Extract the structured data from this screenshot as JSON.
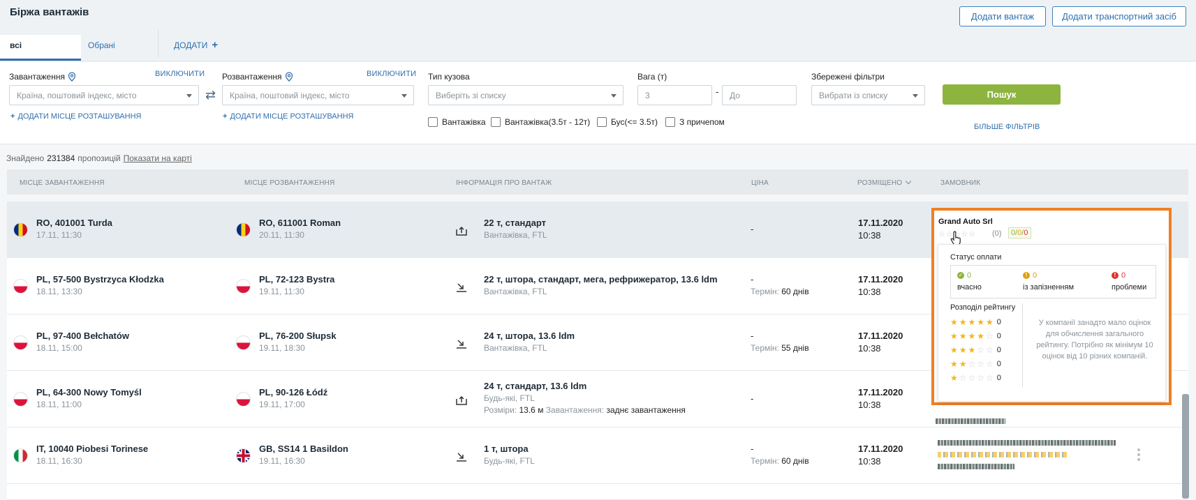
{
  "header": {
    "title": "Біржа вантажів",
    "add_cargo": "Додати вантаж",
    "add_vehicle": "Додати транспортний засіб"
  },
  "tabs": {
    "all": "всі",
    "favorites": "Обрані",
    "add": "ДОДАТИ"
  },
  "filters": {
    "loading_label": "Завантаження",
    "unloading_label": "Розвантаження",
    "exclude": "ВИКЛЮЧИТИ",
    "place_placeholder": "Країна, поштовий індекс, місто",
    "add_location": "ДОДАТИ МІСЦЕ РОЗТАШУВАННЯ",
    "body_type_label": "Тип кузова",
    "body_type_placeholder": "Виберіть зі списку",
    "weight_label": "Вага (т)",
    "weight_from": "3",
    "weight_to_placeholder": "До",
    "weight_dash": "-",
    "saved_label": "Збережені фільтри",
    "saved_placeholder": "Вибрати із списку",
    "search": "Пошук",
    "more": "БІЛЬШЕ ФІЛЬТРІВ",
    "checkboxes": [
      "Вантажівка",
      "Вантажівка(3.5т - 12т)",
      "Бус(<= 3.5т)",
      "З причепом"
    ]
  },
  "summary": {
    "prefix": "Знайдено",
    "count": "231384",
    "suffix": "пропозицій",
    "map_link": "Показати на карті"
  },
  "columns": {
    "loading": "МІСЦЕ ЗАВАНТАЖЕННЯ",
    "unloading": "МІСЦЕ РОЗВАНТАЖЕННЯ",
    "info": "ІНФОРМАЦІЯ ПРО ВАНТАЖ",
    "price": "ЦІНА",
    "posted": "РОЗМІЩЕНО",
    "customer": "ЗАМОВНИК"
  },
  "rows": [
    {
      "from": "RO, 401001 Turda",
      "from_time": "17.11, 11:30",
      "to": "RO, 611001 Roman",
      "to_time": "20.11, 11:30",
      "cargo": "22 т, стандарт",
      "cargo_sub": "Вантажівка, FTL",
      "price": "-",
      "date": "17.11.2020",
      "time": "10:38"
    },
    {
      "from": "PL, 57-500 Bystrzyca Kłodzka",
      "from_time": "18.11, 13:30",
      "to": "PL, 72-123 Bystra",
      "to_time": "19.11, 11:30",
      "cargo": "22 т, штора, стандарт, мега, рефрижератор, 13.6 ldm",
      "cargo_sub": "Вантажівка, FTL",
      "price": "-",
      "term_label": "Термін:",
      "term": "60 днів",
      "date": "17.11.2020",
      "time": "10:38"
    },
    {
      "from": "PL, 97-400 Bełchatów",
      "from_time": "18.11, 15:00",
      "to": "PL, 76-200 Słupsk",
      "to_time": "19.11, 18:30",
      "cargo": "24 т, штора, 13.6 ldm",
      "cargo_sub": "Вантажівка, FTL",
      "price": "-",
      "term_label": "Термін:",
      "term": "55 днів",
      "date": "17.11.2020",
      "time": "10:38"
    },
    {
      "from": "PL, 64-300 Nowy Tomyśl",
      "from_time": "18.11, 11:00",
      "to": "PL, 90-126 Łódź",
      "to_time": "19.11, 17:00",
      "cargo": "24 т, стандарт, 13.6 ldm",
      "cargo_sub": "Будь-які, FTL",
      "dims_label": "Розміри:",
      "dims": "13.6 м",
      "load_label": "Завантаження:",
      "load": "заднє завантаження",
      "price": "-",
      "date": "17.11.2020",
      "time": "10:38"
    },
    {
      "from": "IT, 10040 Piobesi Torinese",
      "from_time": "18.11, 16:30",
      "to": "GB, SS14 1 Basildon",
      "to_time": "19.11, 16:30",
      "cargo": "1 т, штора",
      "cargo_sub": "Будь-які, FTL",
      "price": "-",
      "term_label": "Термін:",
      "term": "60 днів",
      "date": "17.11.2020",
      "time": "10:38"
    }
  ],
  "popup": {
    "company": "Grand Auto Srl",
    "stars": "☆☆☆☆☆",
    "count": "(0)",
    "ratio_ok": "0",
    "ratio_late": "0",
    "ratio_bad": "0",
    "pay_title": "Статус оплати",
    "pay_ok_val": "0",
    "pay_ok": "вчасно",
    "pay_late_val": "0",
    "pay_late": "із запізненням",
    "pay_bad_val": "0",
    "pay_bad": "проблеми",
    "dist_title": "Розподіл рейтингу",
    "dist": [
      "0",
      "0",
      "0",
      "0",
      "0"
    ],
    "note": "У компанії занадто мало оцінок для обчислення загального рейтингу. Потрібно як мінімум 10 оцінок від 10 різних компаній."
  }
}
